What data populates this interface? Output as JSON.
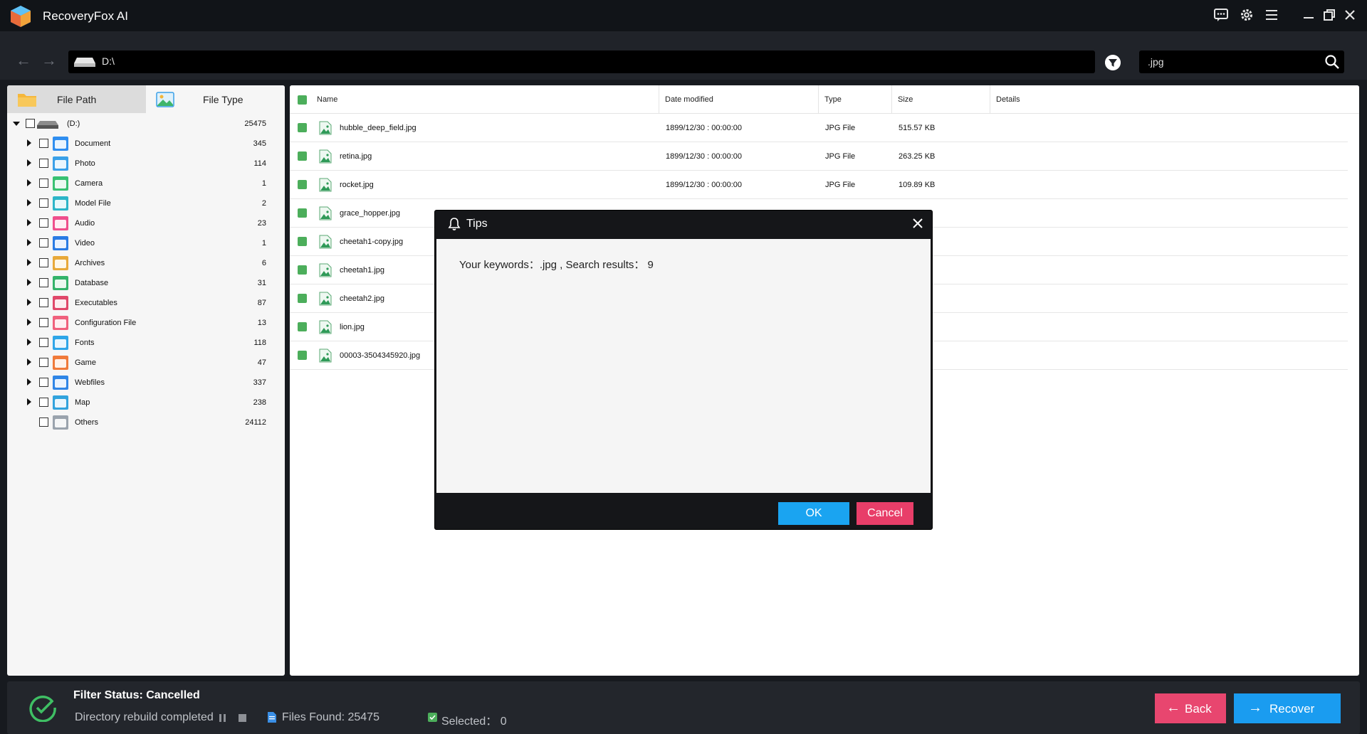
{
  "app": {
    "title": "RecoveryFox AI"
  },
  "titlebar": {
    "icons": [
      "feedback-icon",
      "settings-icon",
      "menu-icon",
      "minimize-icon",
      "restore-icon",
      "close-icon"
    ]
  },
  "nav": {
    "path": "D:\\",
    "search_value": ".jpg"
  },
  "tabs": {
    "file_path": "File Path",
    "file_type": "File Type"
  },
  "tree": {
    "root": {
      "label": "(D:)",
      "count": "25475"
    },
    "items": [
      {
        "label": "Document",
        "count": "345",
        "color": "#2f8ef0",
        "icon": "document-folder-icon"
      },
      {
        "label": "Photo",
        "count": "114",
        "color": "#3aa0e8",
        "icon": "photo-folder-icon"
      },
      {
        "label": "Camera",
        "count": "1",
        "color": "#38c172",
        "icon": "camera-folder-icon"
      },
      {
        "label": "Model File",
        "count": "2",
        "color": "#2eb5c8",
        "icon": "model-folder-icon"
      },
      {
        "label": "Audio",
        "count": "23",
        "color": "#ef4f8c",
        "icon": "audio-folder-icon"
      },
      {
        "label": "Video",
        "count": "1",
        "color": "#2a7be4",
        "icon": "video-folder-icon"
      },
      {
        "label": "Archives",
        "count": "6",
        "color": "#e8a93a",
        "icon": "archives-folder-icon"
      },
      {
        "label": "Database",
        "count": "31",
        "color": "#34b36a",
        "icon": "database-folder-icon"
      },
      {
        "label": "Executables",
        "count": "87",
        "color": "#e0486a",
        "icon": "executables-folder-icon"
      },
      {
        "label": "Configuration File",
        "count": "13",
        "color": "#f0617d",
        "icon": "config-folder-icon"
      },
      {
        "label": "Fonts",
        "count": "118",
        "color": "#2fa6e8",
        "icon": "fonts-folder-icon"
      },
      {
        "label": "Game",
        "count": "47",
        "color": "#f07a3a",
        "icon": "game-folder-icon"
      },
      {
        "label": "Webfiles",
        "count": "337",
        "color": "#2f86e6",
        "icon": "webfiles-folder-icon"
      },
      {
        "label": "Map",
        "count": "238",
        "color": "#32a3dd",
        "icon": "map-folder-icon"
      },
      {
        "label": "Others",
        "count": "24112",
        "color": "#9aa3ad",
        "icon": "others-folder-icon"
      }
    ]
  },
  "columns": {
    "name": "Name",
    "date": "Date modified",
    "type": "Type",
    "size": "Size",
    "details": "Details"
  },
  "files": [
    {
      "name": "hubble_deep_field.jpg",
      "date": "1899/12/30 : 00:00:00",
      "type": "JPG File",
      "size": "515.57 KB"
    },
    {
      "name": "retina.jpg",
      "date": "1899/12/30 : 00:00:00",
      "type": "JPG File",
      "size": "263.25 KB"
    },
    {
      "name": "rocket.jpg",
      "date": "1899/12/30 : 00:00:00",
      "type": "JPG File",
      "size": "109.89 KB"
    },
    {
      "name": "grace_hopper.jpg",
      "date": "",
      "type": "",
      "size": ""
    },
    {
      "name": "cheetah1-copy.jpg",
      "date": "",
      "type": "",
      "size": ""
    },
    {
      "name": "cheetah1.jpg",
      "date": "",
      "type": "",
      "size": ""
    },
    {
      "name": "cheetah2.jpg",
      "date": "",
      "type": "",
      "size": ""
    },
    {
      "name": "lion.jpg",
      "date": "",
      "type": "",
      "size": ""
    },
    {
      "name": "00003-3504345920.jpg",
      "date": "",
      "type": "",
      "size": ""
    }
  ],
  "modal": {
    "title": "Tips",
    "message": "Your keywords：.jpg , Search results： 9",
    "ok": "OK",
    "cancel": "Cancel"
  },
  "status": {
    "title": "Filter Status: Cancelled",
    "sub": "Directory rebuild completed",
    "files_found": "Files Found: 25475",
    "selected": "Selected： 0",
    "back": "Back",
    "recover": "Recover"
  },
  "colors": {
    "accent_blue": "#1a9cf0",
    "accent_pink": "#e8466f",
    "check_green": "#4cae5b"
  }
}
